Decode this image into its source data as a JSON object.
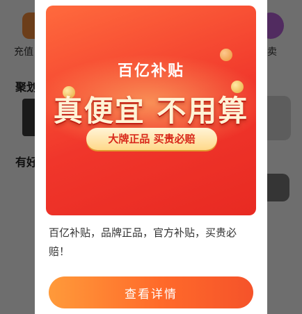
{
  "background": {
    "top_left_label": "充值",
    "top_right_label": "卖",
    "section1_title": "聚划",
    "section2_title": "有好"
  },
  "modal": {
    "banner": {
      "brand": "百亿补贴",
      "headline": "真便宜 不用算",
      "pill": "大牌正品 买贵必赔"
    },
    "description": "百亿补贴，品牌正品，官方补贴，买贵必赔！",
    "cta_label": "查看详情"
  },
  "colors": {
    "banner_red": "#f0362b",
    "cta_orange": "#ff7a2e",
    "pill_text": "#d8281a"
  }
}
